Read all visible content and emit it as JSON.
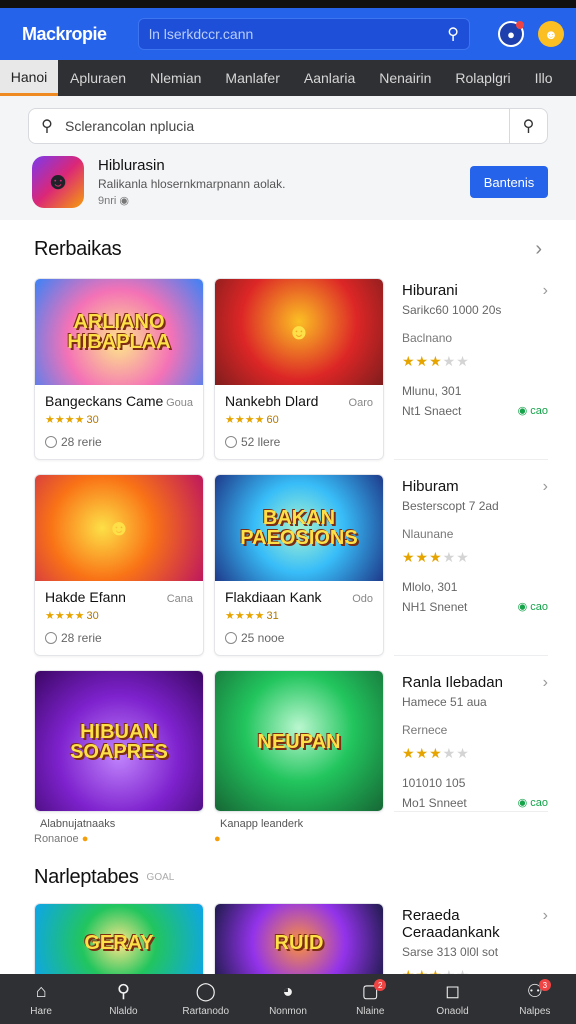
{
  "app": {
    "title": "Mackropie"
  },
  "top_search": {
    "placeholder": "ln lserkdccr.cann"
  },
  "tabs": [
    "Hanoi",
    "Apluraen",
    "Nlemian",
    "Manlafer",
    "Aanlaria",
    "Nenairin",
    "Rolaplgri",
    "Illo"
  ],
  "search": {
    "placeholder": "Sclerancolan nplucia"
  },
  "promo": {
    "title": "Hiblurasin",
    "subtitle": "Ralikanla hlosernkmarpnann aolak.",
    "meta": "9nri",
    "button": "Bantenis"
  },
  "section1": {
    "title": "Rerbaikas"
  },
  "rows": [
    {
      "cards": [
        {
          "art": "ARLIANO HIBAPLAA",
          "name": "Bangeckans Came",
          "tag": "Goua",
          "rating": "30",
          "meta": "28 rerie"
        },
        {
          "art": "",
          "name": "Nankebh Dlard",
          "tag": "Oaro",
          "rating": "60",
          "meta": "52 llere"
        }
      ],
      "side": {
        "title": "Hiburani",
        "sub": "Sarikc60 1000 20s",
        "desc": "Baclnano",
        "stars": 3,
        "m1": "Mlunu, 301",
        "m2": "Nt1 Snaect",
        "m2r": "cao"
      }
    },
    {
      "cards": [
        {
          "art": "",
          "name": "Hakde Efann",
          "tag": "Cana",
          "rating": "30",
          "meta": "28 rerie"
        },
        {
          "art": "BAKAN PAEOSIONS",
          "name": "Flakdiaan Kank",
          "tag": "Odo",
          "rating": "31",
          "meta": "25 nooe"
        }
      ],
      "side": {
        "title": "Hiburam",
        "sub": "Besterscopt 7 2ad",
        "desc": "Nlaunane",
        "stars": 3,
        "m1": "Mlolo, 301",
        "m2": "NH1 Snenet",
        "m2r": "cao"
      }
    },
    {
      "cards": [
        {
          "art": "HIBUAN SOAPRES",
          "name": "",
          "tag": "",
          "rating": "",
          "meta": ""
        },
        {
          "art": "NEUPAN",
          "name": "",
          "tag": "",
          "rating": "",
          "meta": ""
        }
      ],
      "side": {
        "title": "Ranla Ilebadan",
        "sub": "Hamece 51 aua",
        "desc": "Rernece",
        "stars": 3,
        "m1": "101010 105",
        "m2": "Mo1 Snneet",
        "m2r": "cao"
      }
    }
  ],
  "captions": [
    {
      "l1": "Alabnujatnaaks",
      "l2": "Ronanoe"
    },
    {
      "l1": "Kanapp leanderk",
      "l2": ""
    }
  ],
  "section2": {
    "title": "Narleptabes",
    "small": "GOAL"
  },
  "row4": {
    "cards": [
      {
        "art": "GERAY"
      },
      {
        "art": "RUID"
      }
    ],
    "side": {
      "title": "Reraeda Ceraadankank",
      "sub": "Sarse 313 0l0l sot",
      "stars": 3
    }
  },
  "bottom_nav": [
    {
      "label": "Hare",
      "icon": "home-icon",
      "badge": ""
    },
    {
      "label": "Nlaldo",
      "icon": "search-icon",
      "badge": ""
    },
    {
      "label": "Rartanodo",
      "icon": "controller-icon",
      "badge": ""
    },
    {
      "label": "Nonmon",
      "icon": "compass-icon",
      "badge": ""
    },
    {
      "label": "Nlaine",
      "icon": "inbox-icon",
      "badge": "2"
    },
    {
      "label": "Onaold",
      "icon": "square-icon",
      "badge": ""
    },
    {
      "label": "Nalpes",
      "icon": "people-icon",
      "badge": "3"
    }
  ],
  "colors": {
    "primary": "#2563eb",
    "nav_bg": "#2f3033",
    "accent": "#ef8a23",
    "star": "#e6a400"
  }
}
